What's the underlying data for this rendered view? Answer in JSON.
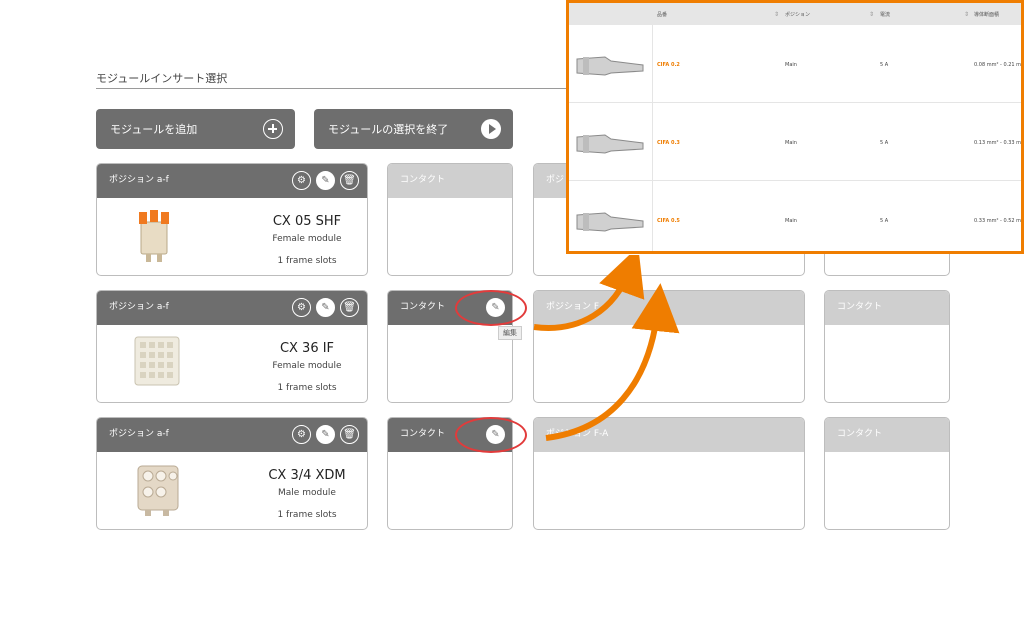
{
  "section": {
    "title": "モジュールインサート選択"
  },
  "actions": {
    "add_module": "モジュールを追加",
    "finish_selection": "モジュールの選択を終了"
  },
  "modules": [
    {
      "position": "ポジション a-f",
      "name": "CX 05 SHF",
      "type": "Female module",
      "slots": "1 frame slots"
    },
    {
      "position": "ポジション a-f",
      "name": "CX 36 IF",
      "type": "Female module",
      "slots": "1 frame slots"
    },
    {
      "position": "ポジション a-f",
      "name": "CX 3/4 XDM",
      "type": "Male module",
      "slots": "1 frame slots"
    }
  ],
  "contact_label": "コンタクト",
  "position_labels": {
    "row1": "ポジ",
    "row2": "ポジション F",
    "row3": "ポジション F-A"
  },
  "tooltip": "編集",
  "popup": {
    "headers": {
      "part_no": "品番",
      "position": "ポジション",
      "current": "電流",
      "cross_section": "導体断面積"
    },
    "rows": [
      {
        "part_no": "CIFA 0.2",
        "position": "Main",
        "current": "5 A",
        "cross_section": "0.08 mm² - 0.21 m"
      },
      {
        "part_no": "CIFA 0.3",
        "position": "Main",
        "current": "5 A",
        "cross_section": "0.13 mm² - 0.33 m"
      },
      {
        "part_no": "CIFA 0.5",
        "position": "Main",
        "current": "5 A",
        "cross_section": "0.33 mm² - 0.52 m"
      }
    ]
  },
  "colors": {
    "accent": "#ef7d00",
    "highlight": "#e23b3b",
    "dark_header": "#6e6e6e",
    "light_header": "#cfcfcf"
  },
  "icons": [
    "plus-circle-icon",
    "play-circle-icon",
    "settings-icon",
    "pencil-icon",
    "trash-icon"
  ]
}
